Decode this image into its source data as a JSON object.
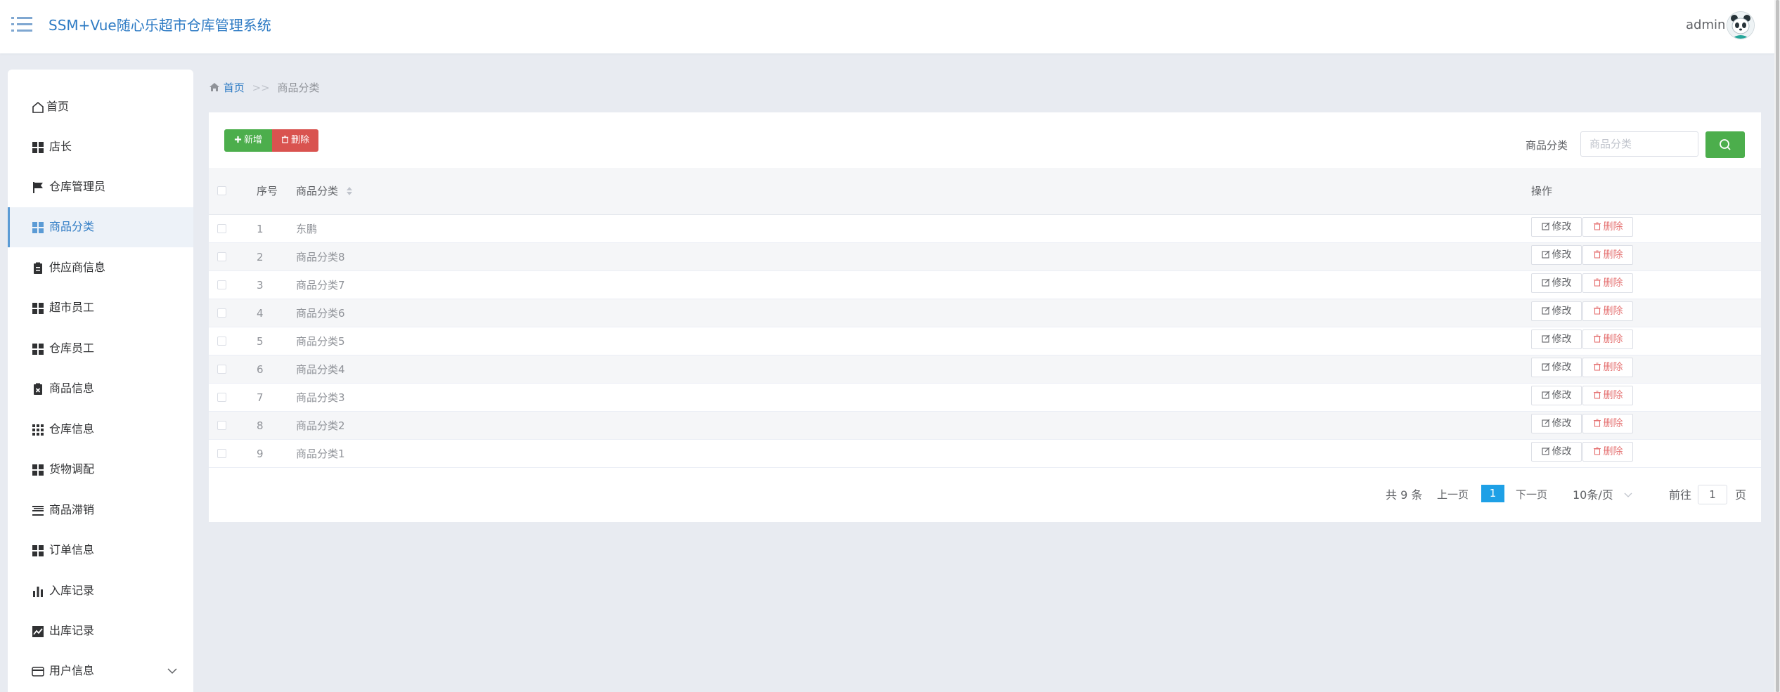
{
  "header": {
    "title": "SSM+Vue随心乐超市仓库管理系统",
    "username": "admin"
  },
  "sidebar": {
    "items": [
      {
        "label": "首页",
        "icon": "home-icon"
      },
      {
        "label": "店长",
        "icon": "grid-icon"
      },
      {
        "label": "仓库管理员",
        "icon": "flag-icon"
      },
      {
        "label": "商品分类",
        "icon": "grid-icon",
        "active": true
      },
      {
        "label": "供应商信息",
        "icon": "clipboard-icon"
      },
      {
        "label": "超市员工",
        "icon": "grid-icon"
      },
      {
        "label": "仓库员工",
        "icon": "grid-icon"
      },
      {
        "label": "商品信息",
        "icon": "clipboard-x-icon"
      },
      {
        "label": "仓库信息",
        "icon": "grid-9-icon"
      },
      {
        "label": "货物调配",
        "icon": "grid-icon"
      },
      {
        "label": "商品滞销",
        "icon": "list-icon"
      },
      {
        "label": "订单信息",
        "icon": "grid-icon"
      },
      {
        "label": "入库记录",
        "icon": "bar-chart-icon"
      },
      {
        "label": "出库记录",
        "icon": "line-chart-icon"
      },
      {
        "label": "用户信息",
        "icon": "card-icon",
        "has_submenu": true
      }
    ]
  },
  "breadcrumb": {
    "home": "首页",
    "separator": ">>",
    "current": "商品分类"
  },
  "toolbar": {
    "add_label": "新增",
    "delete_label": "删除"
  },
  "search": {
    "label": "商品分类",
    "placeholder": "商品分类"
  },
  "table": {
    "columns": {
      "index": "序号",
      "category": "商品分类",
      "actions": "操作"
    },
    "rows": [
      {
        "index": "1",
        "category": "东鹏"
      },
      {
        "index": "2",
        "category": "商品分类8"
      },
      {
        "index": "3",
        "category": "商品分类7"
      },
      {
        "index": "4",
        "category": "商品分类6"
      },
      {
        "index": "5",
        "category": "商品分类5"
      },
      {
        "index": "6",
        "category": "商品分类4"
      },
      {
        "index": "7",
        "category": "商品分类3"
      },
      {
        "index": "8",
        "category": "商品分类2"
      },
      {
        "index": "9",
        "category": "商品分类1"
      }
    ],
    "edit_label": "修改",
    "delete_label": "删除"
  },
  "pagination": {
    "total": "共 9 条",
    "prev": "上一页",
    "current_page": "1",
    "next": "下一页",
    "page_size": "10条/页",
    "goto_label": "前往",
    "goto_value": "1",
    "page_suffix": "页"
  },
  "colors": {
    "brand": "#2e7bc4",
    "success": "#4cae4c",
    "danger": "#d9534f",
    "page_active": "#1ea0e6"
  }
}
